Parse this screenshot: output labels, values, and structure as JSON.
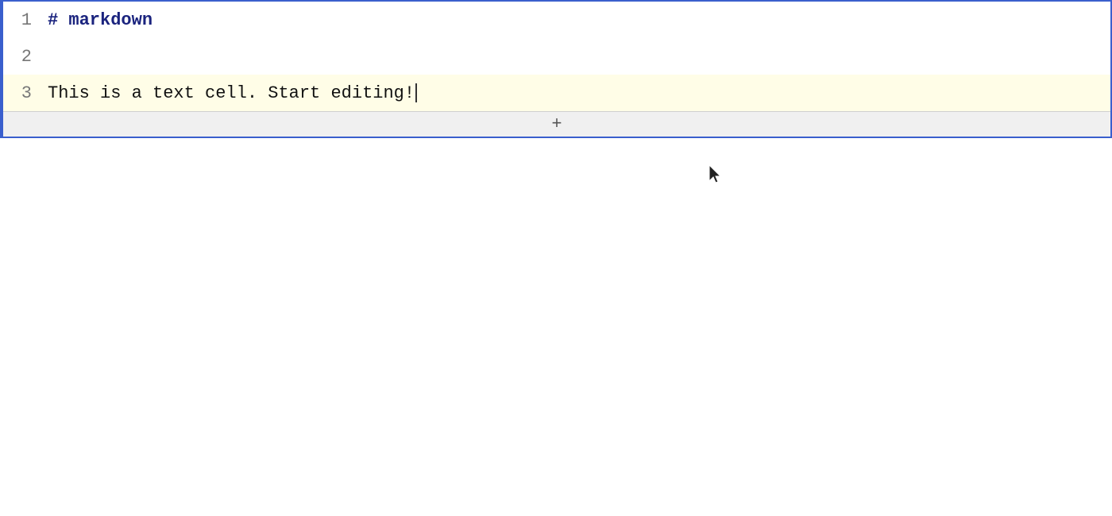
{
  "editor": {
    "lines": [
      {
        "number": "1",
        "content_plain": "",
        "content_parts": [
          {
            "type": "keyword",
            "text": "# markdown"
          }
        ],
        "highlight": false
      },
      {
        "number": "2",
        "content_plain": "",
        "content_parts": [],
        "highlight": false
      },
      {
        "number": "3",
        "content_plain": "This is a text cell. Start editing!",
        "content_parts": [
          {
            "type": "plain",
            "text": "This is a text cell. Start editing!"
          }
        ],
        "highlight": true,
        "has_cursor": true
      }
    ],
    "add_cell_label": "+"
  }
}
